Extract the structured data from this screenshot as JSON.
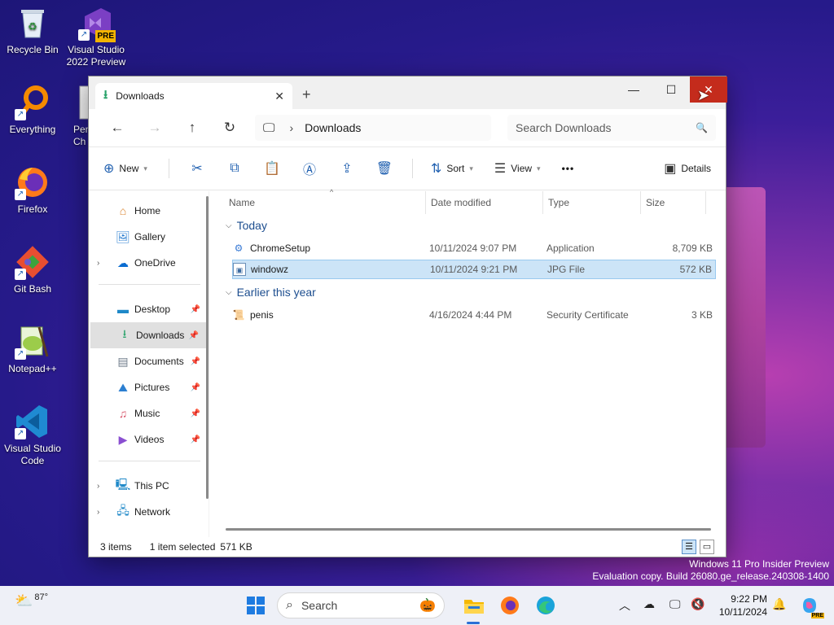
{
  "desktop": {
    "icons": [
      {
        "label": "Recycle Bin"
      },
      {
        "label": "Visual Studio 2022 Preview",
        "badge": "PRE"
      },
      {
        "label": "Everything"
      },
      {
        "label": "Pen Ch"
      },
      {
        "label": "Firefox"
      },
      {
        "label": "Git Bash"
      },
      {
        "label": "Notepad++"
      },
      {
        "label": "Visual Studio Code"
      }
    ]
  },
  "window": {
    "tab_title": "Downloads",
    "nav": {
      "address_current": "Downloads",
      "search_placeholder": "Search Downloads"
    },
    "commands": {
      "new": "New",
      "sort": "Sort",
      "view": "View",
      "more": "•••",
      "details": "Details"
    },
    "sidebar": {
      "items": [
        {
          "label": "Home"
        },
        {
          "label": "Gallery"
        },
        {
          "label": "OneDrive"
        },
        {
          "label": "Desktop"
        },
        {
          "label": "Downloads"
        },
        {
          "label": "Documents"
        },
        {
          "label": "Pictures"
        },
        {
          "label": "Music"
        },
        {
          "label": "Videos"
        },
        {
          "label": "This PC"
        },
        {
          "label": "Network"
        }
      ]
    },
    "columns": {
      "name": "Name",
      "date": "Date modified",
      "type": "Type",
      "size": "Size"
    },
    "groups": [
      {
        "title": "Today",
        "rows": [
          {
            "name": "ChromeSetup",
            "date": "10/11/2024 9:07 PM",
            "type": "Application",
            "size": "8,709 KB"
          },
          {
            "name": "windowz",
            "date": "10/11/2024 9:21 PM",
            "type": "JPG File",
            "size": "572 KB"
          }
        ]
      },
      {
        "title": "Earlier this year",
        "rows": [
          {
            "name": "penis",
            "date": "4/16/2024 4:44 PM",
            "type": "Security Certificate",
            "size": "3 KB"
          }
        ]
      }
    ],
    "status": {
      "count": "3 items",
      "selection": "1 item selected",
      "selection_size": "571 KB"
    }
  },
  "watermark": {
    "line1": "Windows 11 Pro Insider Preview",
    "line2": "Evaluation copy. Build 26080.ge_release.240308-1400"
  },
  "taskbar": {
    "weather_temp": "87°",
    "search_label": "Search",
    "time": "9:22 PM",
    "date": "10/11/2024",
    "copilot_badge": "PRE"
  },
  "colors": {
    "accent": "#2a6fd6",
    "close_red": "#c42b1c",
    "selection": "#cce4f7"
  }
}
